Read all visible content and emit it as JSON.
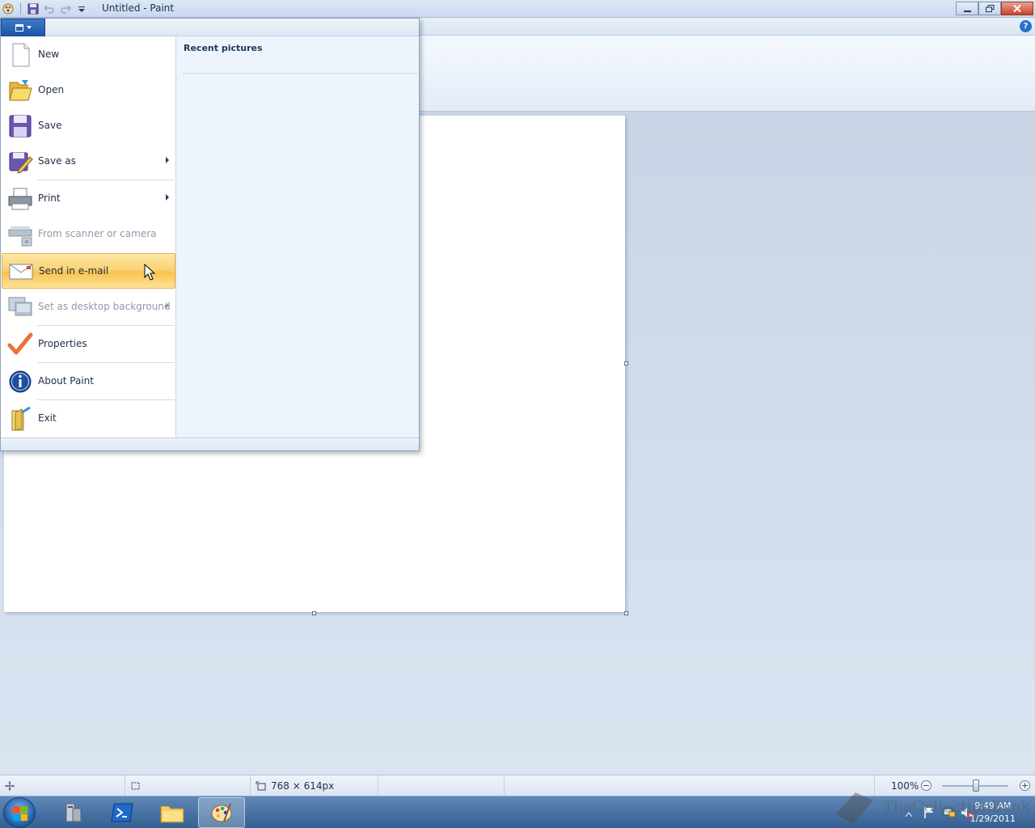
{
  "window": {
    "title": "Untitled - Paint",
    "controls": [
      "minimize-icon",
      "restore-icon",
      "close-icon"
    ]
  },
  "quick_access": [
    "save-icon",
    "undo-icon",
    "redo-icon",
    "customize-dropdown-icon"
  ],
  "app_menu": {
    "items": [
      {
        "label": "New",
        "icon": "new-document-icon",
        "enabled": true,
        "submenu": false
      },
      {
        "label": "Open",
        "icon": "open-folder-icon",
        "enabled": true,
        "submenu": false
      },
      {
        "label": "Save",
        "icon": "save-disk-icon",
        "enabled": true,
        "submenu": false
      },
      {
        "label": "Save as",
        "icon": "save-as-icon",
        "enabled": true,
        "submenu": true
      },
      {
        "label": "Print",
        "icon": "printer-icon",
        "enabled": true,
        "submenu": true
      },
      {
        "label": "From scanner or camera",
        "icon": "scanner-icon",
        "enabled": false,
        "submenu": false
      },
      {
        "label": "Send in e-mail",
        "icon": "email-icon",
        "enabled": true,
        "submenu": false,
        "highlighted": true
      },
      {
        "label": "Set as desktop background",
        "icon": "desktop-background-icon",
        "enabled": false,
        "submenu": true
      },
      {
        "label": "Properties",
        "icon": "checkmark-icon",
        "enabled": true,
        "submenu": false
      },
      {
        "label": "About Paint",
        "icon": "info-icon",
        "enabled": true,
        "submenu": false
      },
      {
        "label": "Exit",
        "icon": "exit-icon",
        "enabled": true,
        "submenu": false
      }
    ],
    "recent_title": "Recent pictures"
  },
  "statusbar": {
    "image_size": "768 × 614px",
    "zoom": "100%",
    "zoom_fraction": 0.5
  },
  "taskbar": {
    "clock_time": "9:49 AM",
    "clock_date": "1/29/2011",
    "watermark": "TheCollectionBook"
  },
  "colors": {
    "accent": "#1d58a8",
    "highlight": "#fbd375",
    "taskbar": "#345f92"
  }
}
